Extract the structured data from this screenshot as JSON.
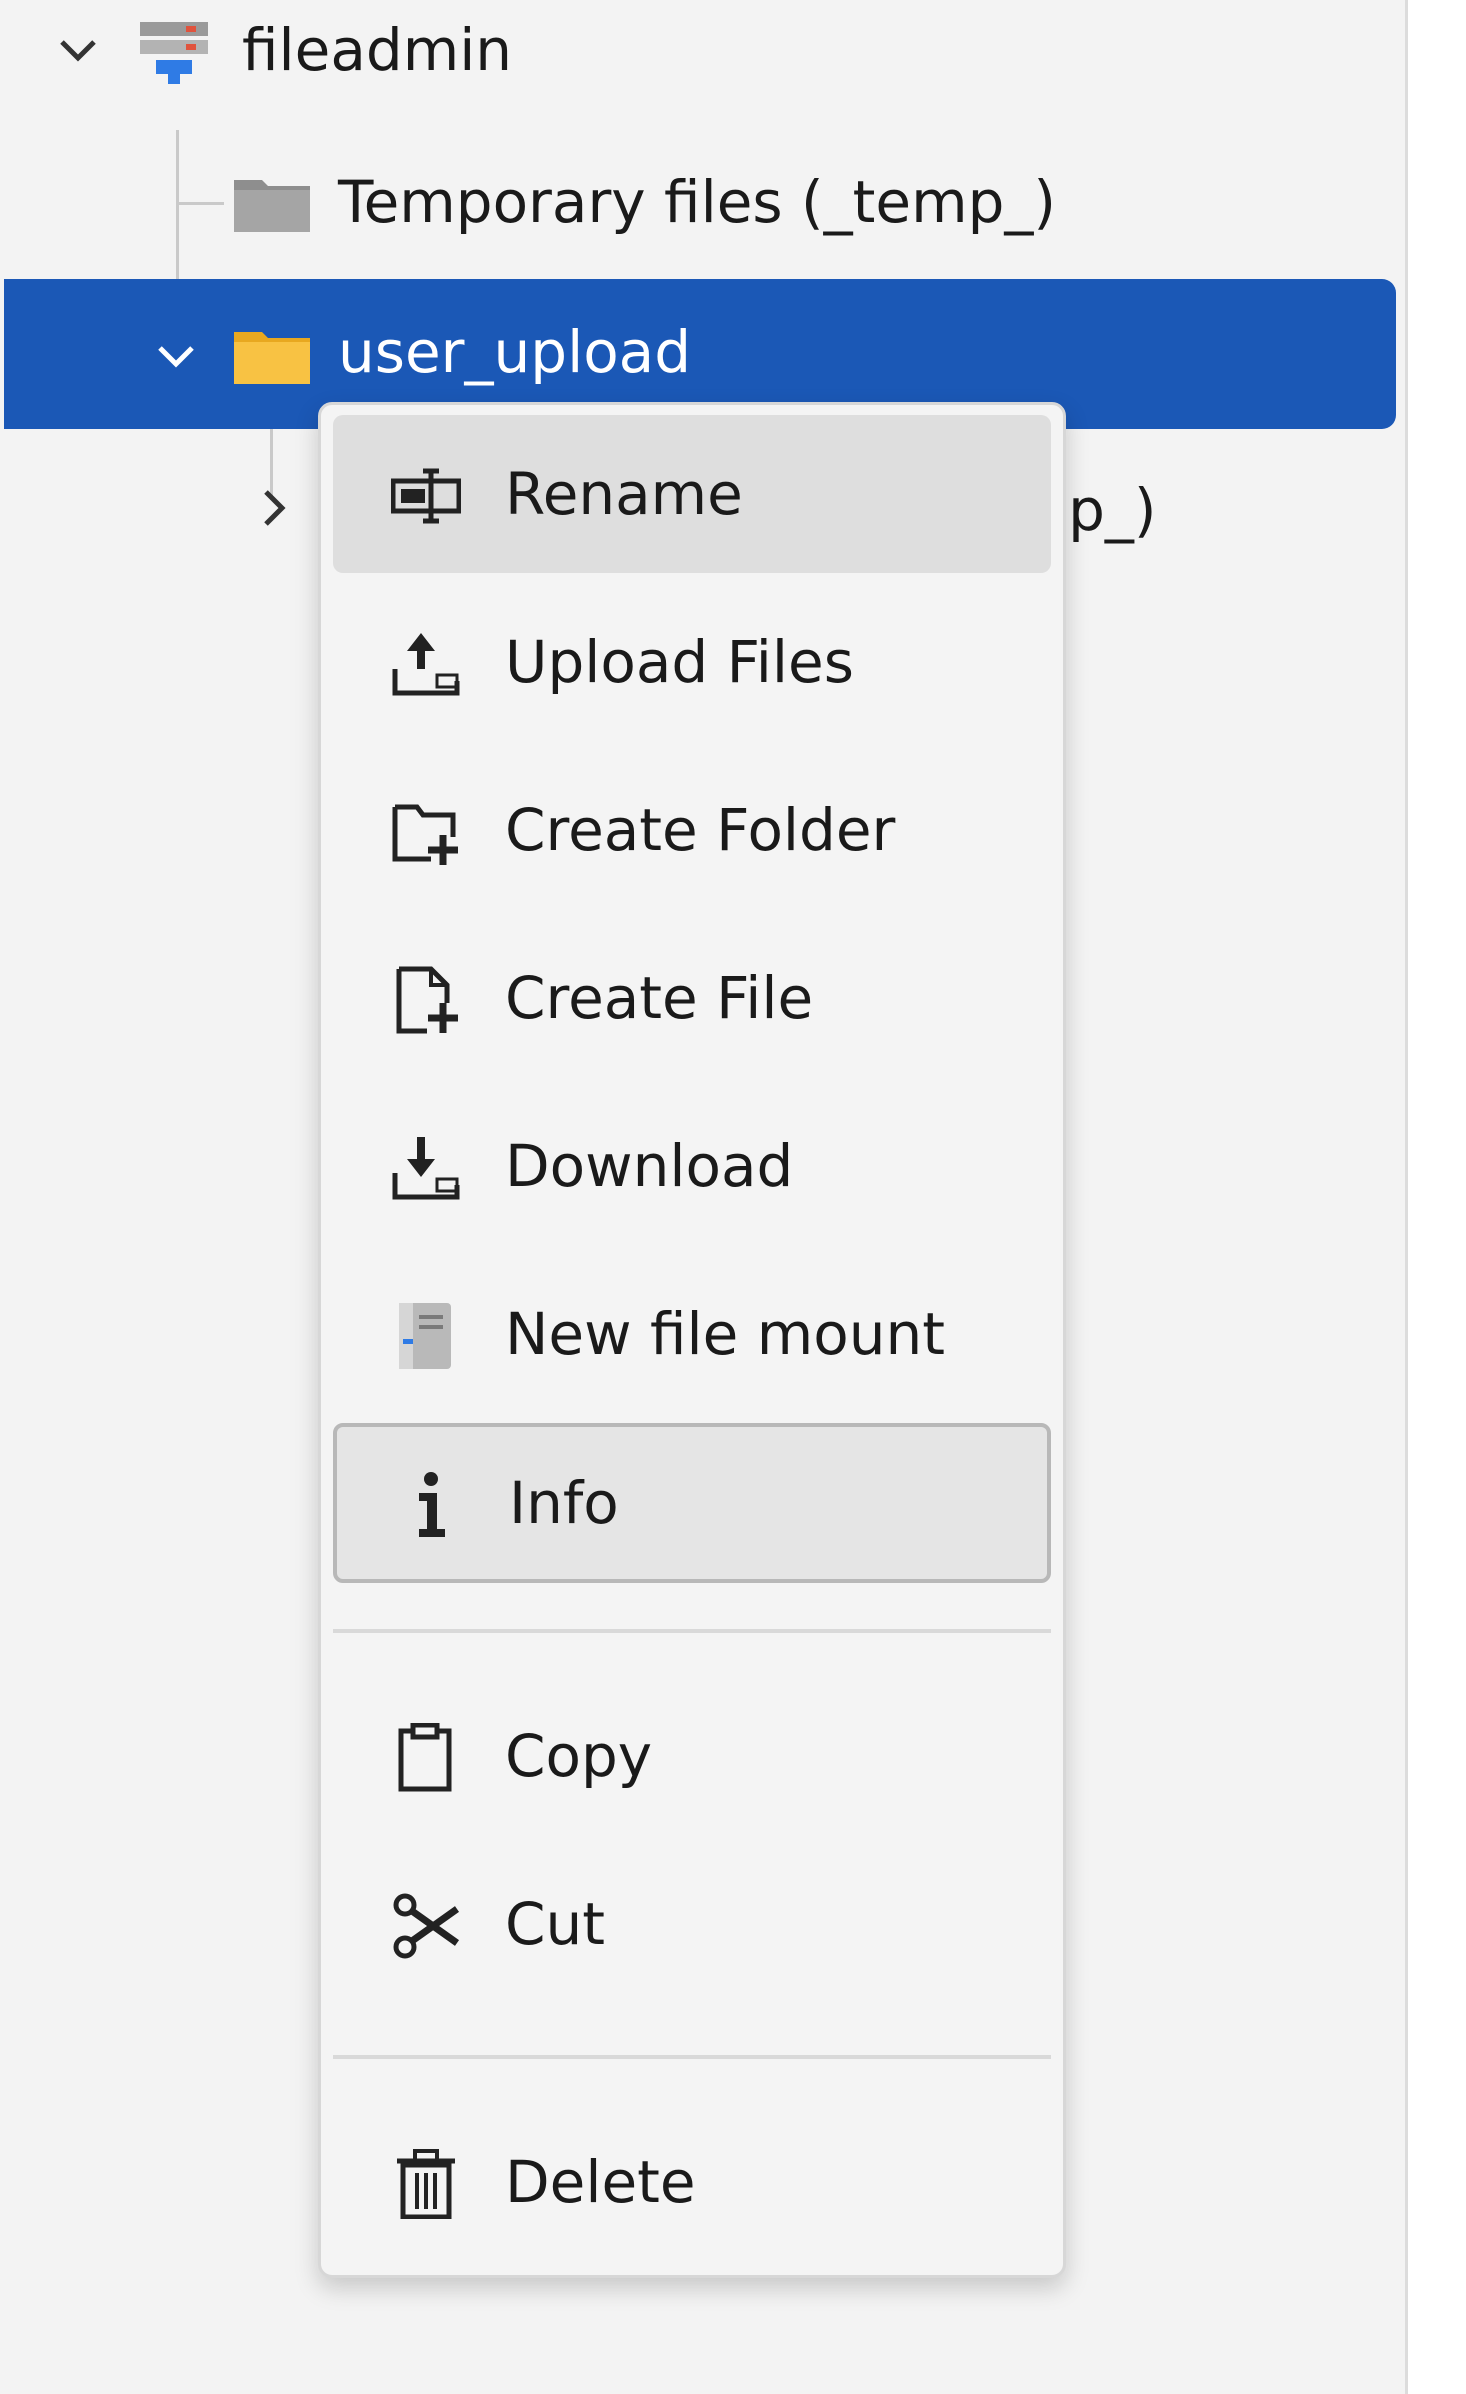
{
  "tree": {
    "root": {
      "label": "fileadmin",
      "icon": "storage-icon",
      "expanded": true
    },
    "items": [
      {
        "label": "Temporary files (_temp_)",
        "icon": "folder-gray-icon"
      },
      {
        "label": "user_upload",
        "icon": "folder-yellow-icon",
        "expanded": true,
        "selected": true
      },
      {
        "label_visible_fragment": "ıp_)",
        "icon": "folder-gray-icon",
        "expanded": false
      }
    ]
  },
  "context_menu": {
    "items": [
      {
        "label": "Rename",
        "icon": "rename-icon",
        "state": "hover"
      },
      {
        "label": "Upload Files",
        "icon": "upload-icon"
      },
      {
        "label": "Create Folder",
        "icon": "create-folder-icon"
      },
      {
        "label": "Create File",
        "icon": "create-file-icon"
      },
      {
        "label": "Download",
        "icon": "download-icon"
      },
      {
        "label": "New file mount",
        "icon": "file-mount-icon"
      },
      {
        "label": "Info",
        "icon": "info-icon",
        "state": "focus"
      },
      {
        "label": "Copy",
        "icon": "copy-icon"
      },
      {
        "label": "Cut",
        "icon": "scissors-icon"
      },
      {
        "label": "Delete",
        "icon": "trash-icon"
      }
    ]
  },
  "colors": {
    "selection": "#1b58b6",
    "folder_yellow": "#f8c243",
    "folder_gray": "#8e8e8e",
    "menu_bg": "#f4f4f4",
    "hover_bg": "#dedede"
  }
}
